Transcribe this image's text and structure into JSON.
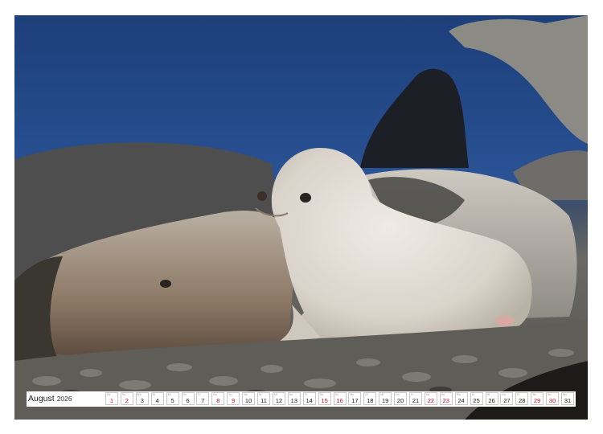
{
  "calendar": {
    "month": "August",
    "year": "2026"
  },
  "days": [
    {
      "n": "1",
      "wd": "Sa",
      "weekend": true
    },
    {
      "n": "2",
      "wd": "So",
      "weekend": true
    },
    {
      "n": "3",
      "wd": "Mo",
      "weekend": false
    },
    {
      "n": "4",
      "wd": "Di",
      "weekend": false
    },
    {
      "n": "5",
      "wd": "Mi",
      "weekend": false
    },
    {
      "n": "6",
      "wd": "Do",
      "weekend": false
    },
    {
      "n": "7",
      "wd": "Fr",
      "weekend": false
    },
    {
      "n": "8",
      "wd": "Sa",
      "weekend": true
    },
    {
      "n": "9",
      "wd": "So",
      "weekend": true
    },
    {
      "n": "10",
      "wd": "Mo",
      "weekend": false
    },
    {
      "n": "11",
      "wd": "Di",
      "weekend": false
    },
    {
      "n": "12",
      "wd": "Mi",
      "weekend": false
    },
    {
      "n": "13",
      "wd": "Do",
      "weekend": false
    },
    {
      "n": "14",
      "wd": "Fr",
      "weekend": false
    },
    {
      "n": "15",
      "wd": "Sa",
      "weekend": true
    },
    {
      "n": "16",
      "wd": "So",
      "weekend": true
    },
    {
      "n": "17",
      "wd": "Mo",
      "weekend": false
    },
    {
      "n": "18",
      "wd": "Di",
      "weekend": false
    },
    {
      "n": "19",
      "wd": "Mi",
      "weekend": false
    },
    {
      "n": "20",
      "wd": "Do",
      "weekend": false
    },
    {
      "n": "21",
      "wd": "Fr",
      "weekend": false
    },
    {
      "n": "22",
      "wd": "Sa",
      "weekend": true
    },
    {
      "n": "23",
      "wd": "So",
      "weekend": true
    },
    {
      "n": "24",
      "wd": "Mo",
      "weekend": false
    },
    {
      "n": "25",
      "wd": "Di",
      "weekend": false
    },
    {
      "n": "26",
      "wd": "Mi",
      "weekend": false
    },
    {
      "n": "27",
      "wd": "Do",
      "weekend": false
    },
    {
      "n": "28",
      "wd": "Fr",
      "weekend": false
    },
    {
      "n": "29",
      "wd": "Sa",
      "weekend": true
    },
    {
      "n": "30",
      "wd": "So",
      "weekend": true
    },
    {
      "n": "31",
      "wd": "Mo",
      "weekend": false
    }
  ],
  "colors": {
    "weekend": "#c8102e",
    "weekday": "#222222",
    "sea": "#254c8d"
  }
}
